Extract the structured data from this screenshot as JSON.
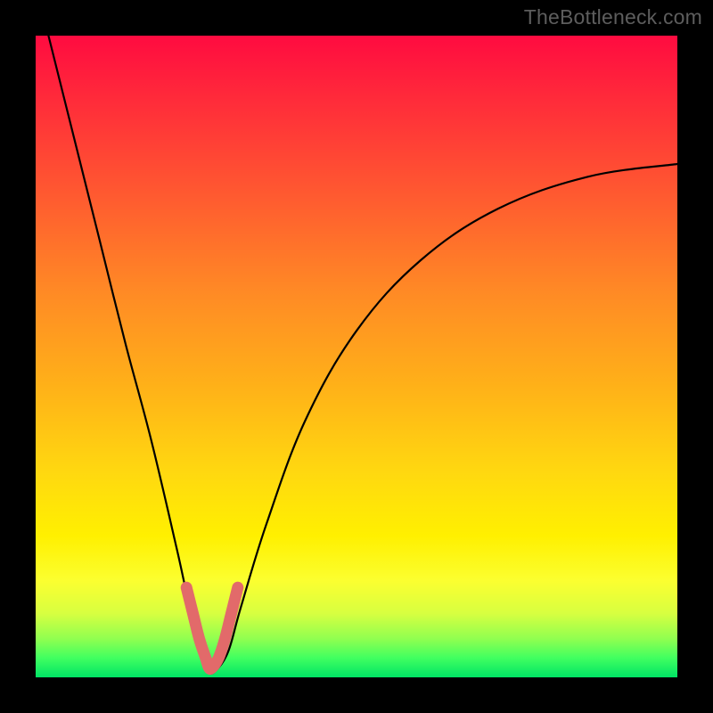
{
  "watermark": "TheBottleneck.com",
  "chart_data": {
    "type": "line",
    "title": "",
    "xlabel": "",
    "ylabel": "",
    "xlim": [
      0,
      100
    ],
    "ylim": [
      0,
      100
    ],
    "background_gradient": {
      "top_color": "#ff0b40",
      "bottom_color": "#00e465",
      "meaning": "red_high_to_green_low"
    },
    "series": [
      {
        "name": "bottleneck-curve",
        "stroke": "#000000",
        "x": [
          2,
          6,
          10,
          14,
          18,
          22,
          24,
          26,
          27,
          28,
          30,
          32,
          36,
          42,
          50,
          60,
          72,
          86,
          100
        ],
        "values": [
          100,
          84,
          68,
          52,
          37,
          20,
          11,
          4,
          1,
          1,
          4,
          11,
          24,
          40,
          54,
          65,
          73,
          78,
          80
        ]
      },
      {
        "name": "optimal-zone-marker",
        "stroke": "#e26a6a",
        "x": [
          23.5,
          24.5,
          25.5,
          26.5,
          27.0,
          27.5,
          28.5,
          29.5,
          30.5,
          31.5
        ],
        "values": [
          14,
          10,
          6,
          3,
          1.5,
          1.5,
          3,
          6,
          10,
          14
        ]
      }
    ],
    "annotations": []
  }
}
